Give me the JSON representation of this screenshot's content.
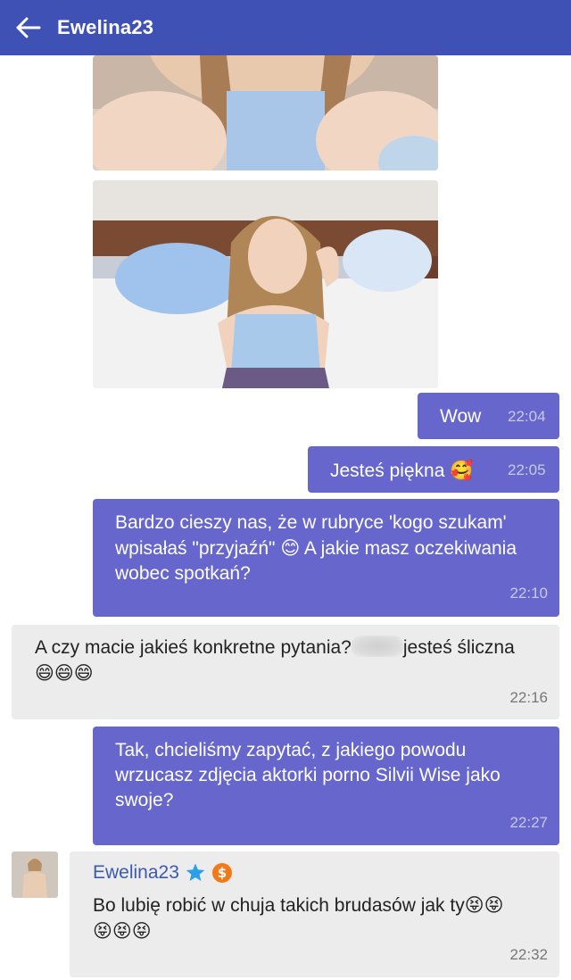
{
  "header": {
    "title": "Ewelina23",
    "back_icon": "arrow-left-icon",
    "bg_color": "#3f51b5"
  },
  "colors": {
    "outgoing_bubble": "#6666cc",
    "incoming_bubble": "#ececec",
    "sender_name": "#3b5ab0"
  },
  "messages": [
    {
      "dir": "out",
      "text": "Wow",
      "time": "22:04"
    },
    {
      "dir": "out",
      "text": "Jesteś piękna",
      "emoji": "🥰",
      "time": "22:05"
    },
    {
      "dir": "out",
      "text": "Bardzo cieszy nas, że w rubryce 'kogo szukam' wpisałaś \"przyjaźń\"",
      "emoji": "😊",
      "text2": "A jakie masz oczekiwania wobec spotkań?",
      "time": "22:10"
    },
    {
      "dir": "in",
      "text": "A czy macie jakieś konkretne pytania?",
      "text2": "jesteś śliczna",
      "emoji": "😄😄😄",
      "time": "22:16"
    },
    {
      "dir": "out",
      "text": "Tak, chcieliśmy zapytać, z jakiego powodu wrzucasz zdjęcia aktorki porno Silvii Wise jako swoje?",
      "time": "22:27"
    },
    {
      "dir": "in",
      "sender": "Ewelina23",
      "sender_icons": [
        "star-icon",
        "dollar-coin-icon"
      ],
      "text": "Bo lubię robić w chuja takich brudasów jak ty",
      "emoji": "😝😝",
      "emoji2": "😝😝😝",
      "time": "22:32"
    }
  ]
}
